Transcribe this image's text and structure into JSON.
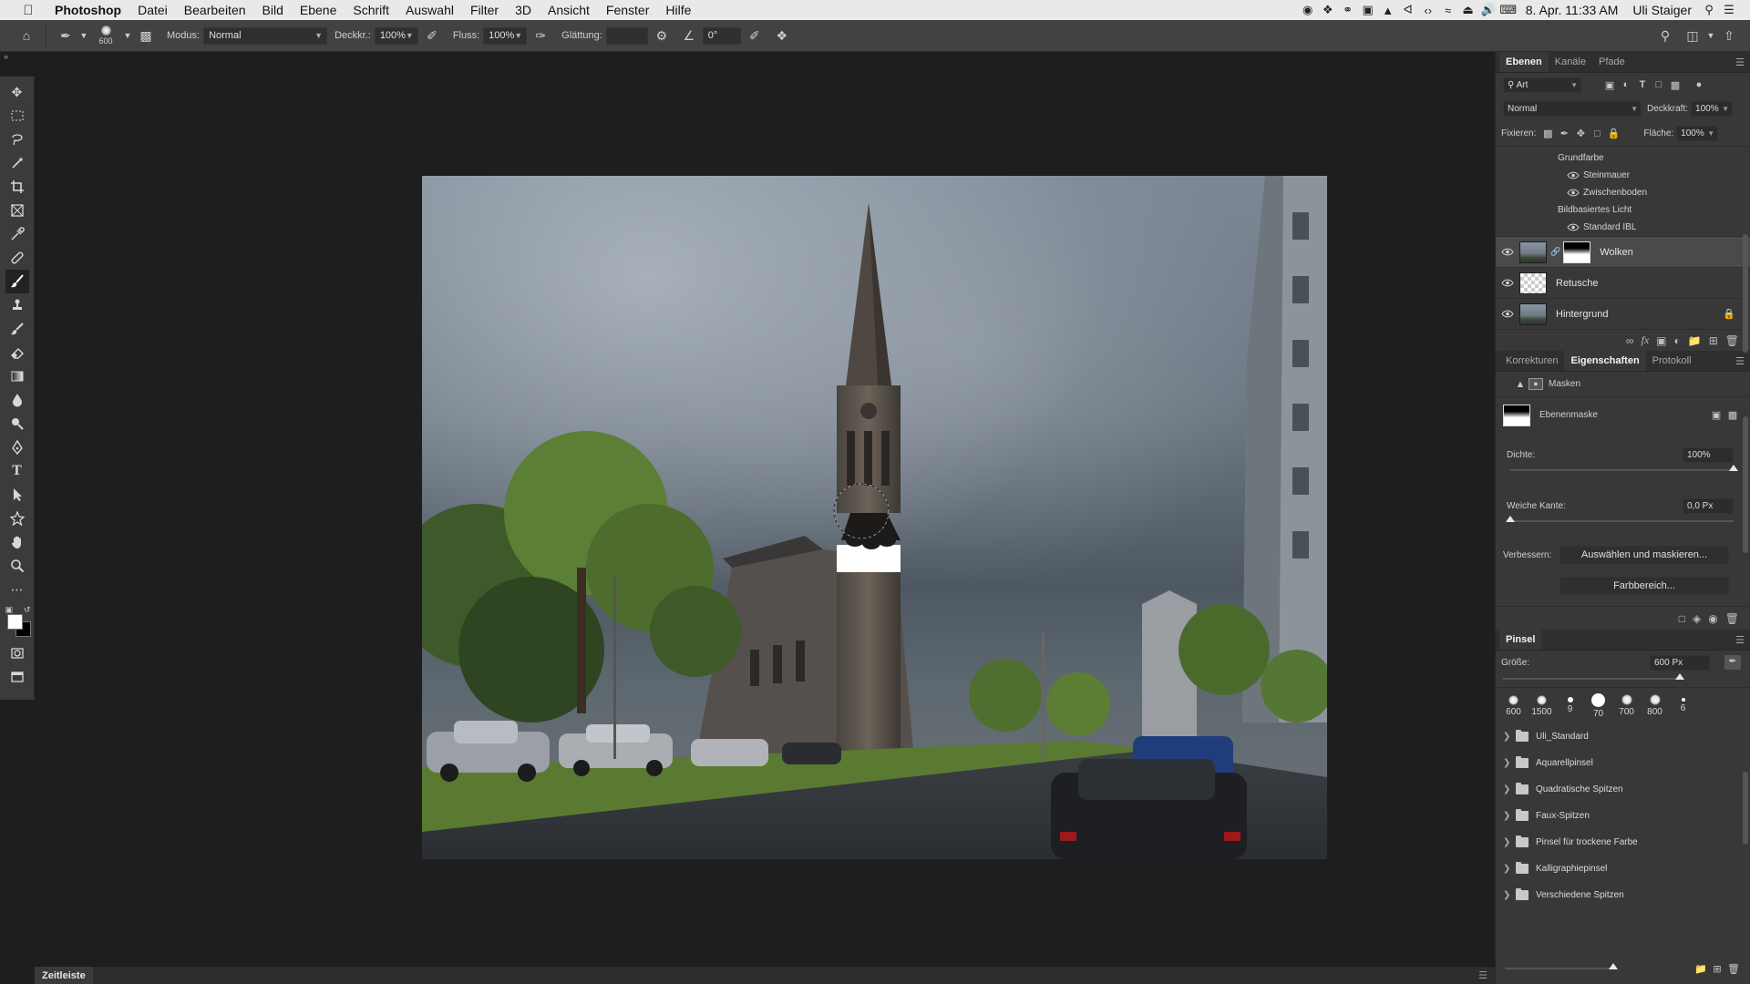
{
  "menubar": {
    "app": "Photoshop",
    "items": [
      "Datei",
      "Bearbeiten",
      "Bild",
      "Ebene",
      "Schrift",
      "Auswahl",
      "Filter",
      "3D",
      "Ansicht",
      "Fenster",
      "Hilfe"
    ],
    "clock": "8. Apr. 11:33 AM",
    "user": "Uli Staiger"
  },
  "options": {
    "brush_size": "600",
    "mode_label": "Modus:",
    "mode_value": "Normal",
    "opacity_label": "Deckkr.:",
    "opacity_value": "100%",
    "flow_label": "Fluss:",
    "flow_value": "100%",
    "smoothing_label": "Glättung:",
    "smoothing_value": "",
    "angle_value": "0°"
  },
  "layers_panel": {
    "tabs": [
      "Ebenen",
      "Kanäle",
      "Pfade"
    ],
    "filter_value": "Art",
    "blend_value": "Normal",
    "opacity_label": "Deckkraft:",
    "opacity_value": "100%",
    "lock_label": "Fixieren:",
    "fill_label": "Fläche:",
    "fill_value": "100%",
    "sub_items": {
      "grundfarbe": "Grundfarbe",
      "steinmauer": "Steinmauer",
      "zwischenboden": "Zwischenboden",
      "bildbasiert": "Bildbasiertes Licht",
      "standard_ibl": "Standard IBL"
    },
    "layers": [
      "Wolken",
      "Retusche",
      "Hintergrund"
    ]
  },
  "properties_panel": {
    "tabs": [
      "Korrekturen",
      "Eigenschaften",
      "Protokoll"
    ],
    "section": "Masken",
    "mask_name": "Ebenenmaske",
    "density_label": "Dichte:",
    "density_value": "100%",
    "density_level": 1.0,
    "feather_label": "Weiche Kante:",
    "feather_value": "0,0 Px",
    "feather_level": 0.0,
    "refine_label": "Verbessern:",
    "select_mask_button": "Auswählen und maskieren...",
    "color_range_button": "Farbbereich..."
  },
  "brush_panel": {
    "title": "Pinsel",
    "size_label": "Größe:",
    "size_value": "600 Px",
    "tips": [
      "600",
      "1500",
      "9",
      "70",
      "700",
      "800",
      "6"
    ],
    "folders": [
      "Uli_Standard",
      "Aquarellpinsel",
      "Quadratische Spitzen",
      "Faux-Spitzen",
      "Pinsel für trockene Farbe",
      "Kalligraphiepinsel",
      "Verschiedene Spitzen"
    ]
  },
  "timeline": {
    "tab": "Zeitleiste"
  },
  "colors": {
    "accent": "#4a4a4a",
    "foreground_swatch": "#ffffff",
    "background_swatch": "#000000"
  }
}
